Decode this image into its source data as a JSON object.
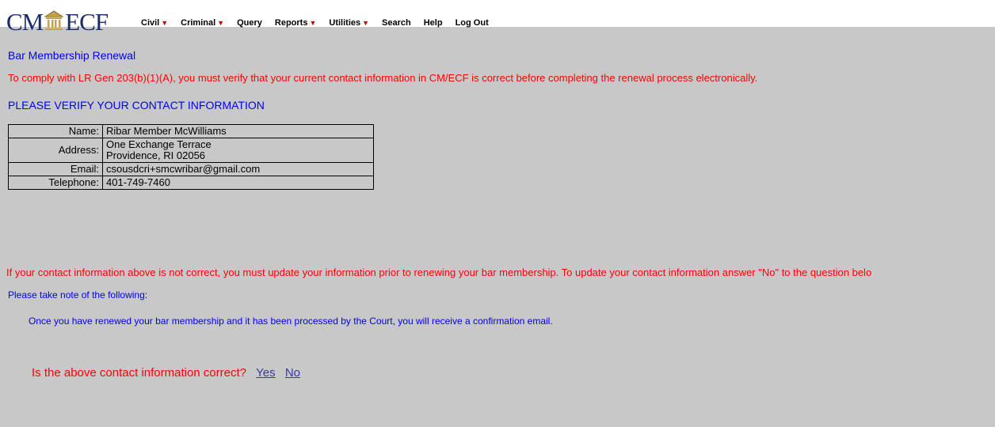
{
  "header": {
    "logo_left": "CM",
    "logo_right": "ECF",
    "menu": [
      {
        "label": "Civil",
        "has_caret": true
      },
      {
        "label": "Criminal",
        "has_caret": true
      },
      {
        "label": "Query",
        "has_caret": false
      },
      {
        "label": "Reports",
        "has_caret": true
      },
      {
        "label": "Utilities",
        "has_caret": true
      },
      {
        "label": "Search",
        "has_caret": false
      },
      {
        "label": "Help",
        "has_caret": false
      },
      {
        "label": "Log Out",
        "has_caret": false
      }
    ]
  },
  "page": {
    "title": "Bar Membership Renewal",
    "notice": "To comply with LR Gen 203(b)(1)(A), you must verify that your current contact information in CM/ECF is correct before completing the renewal process electronically.",
    "verify_heading": "PLEASE VERIFY YOUR CONTACT INFORMATION",
    "contact": {
      "name_label": "Name:",
      "name": "Ribar Member McWilliams",
      "address_label": "Address:",
      "address_line1": "One Exchange Terrace",
      "address_line2": "Providence, RI 02056",
      "email_label": "Email:",
      "email": "csousdcri+smcwribar@gmail.com",
      "telephone_label": "Telephone:",
      "telephone": "401-749-7460"
    },
    "update_notice": "If your contact information above is not correct, you must update your information prior to renewing your bar membership.  To update your contact information answer \"No\" to the question belo",
    "note_heading": "Please take note of the following:",
    "note_text": "Once you have renewed your bar membership and it has been processed by the Court, you will receive a confirmation email.",
    "question": "Is the above contact information correct?",
    "yes_label": "Yes",
    "no_label": "No"
  },
  "colors": {
    "background": "#c8c8c8",
    "blue_text": "#0000ee",
    "red_text": "#ff0000",
    "logo": "#1a2d6b"
  }
}
